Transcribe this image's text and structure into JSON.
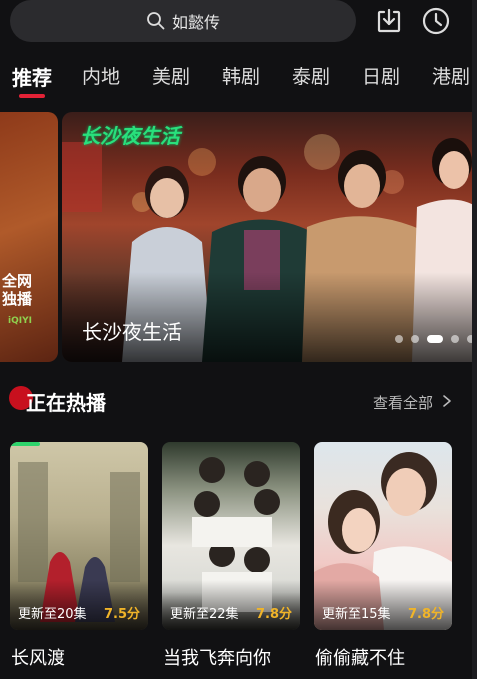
{
  "search": {
    "text": "如懿传"
  },
  "top_icons": [
    "download-icon",
    "history-clock-icon"
  ],
  "tabs": [
    {
      "label": "推荐",
      "active": true
    },
    {
      "label": "内地"
    },
    {
      "label": "美剧"
    },
    {
      "label": "韩剧"
    },
    {
      "label": "泰剧"
    },
    {
      "label": "日剧"
    },
    {
      "label": "港剧"
    }
  ],
  "banner": {
    "prev_partial_text": "全网\n独播",
    "prev_partial_logo": "iQIYI",
    "logo_text": "长沙夜生活",
    "title": "长沙夜生活",
    "dots_count": 6,
    "active_dot": 2
  },
  "section": {
    "title": "正在热播",
    "see_all": "查看全部"
  },
  "cards": [
    {
      "title": "长风渡",
      "episode": "更新至20集",
      "score": "7.5分"
    },
    {
      "title": "当我飞奔向你",
      "episode": "更新至22集",
      "score": "7.8分"
    },
    {
      "title": "偷偷藏不住",
      "episode": "更新至15集",
      "score": "7.8分"
    }
  ],
  "colors": {
    "accent": "#e32236",
    "score": "#f0b429",
    "background": "#111113"
  }
}
